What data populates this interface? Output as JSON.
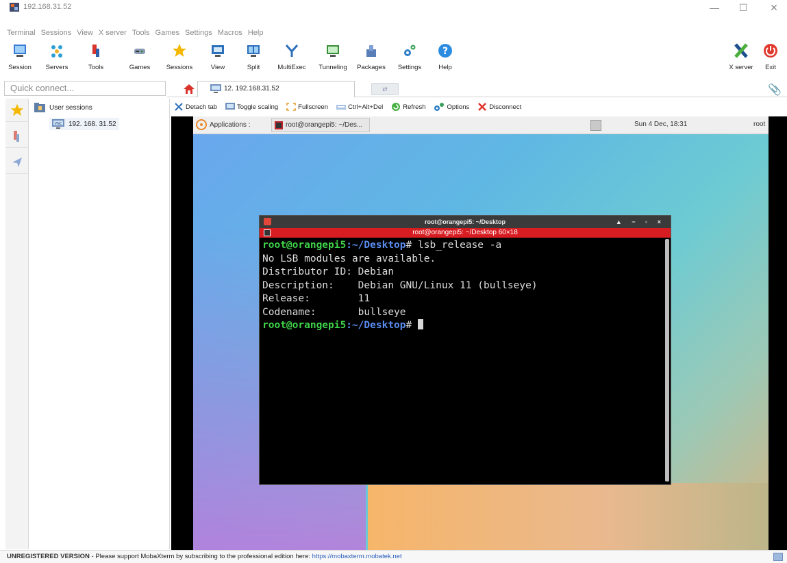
{
  "window": {
    "title": "192.168.31.52",
    "minimize": "—",
    "maximize": "☐",
    "close": "✕"
  },
  "menu": [
    "Terminal",
    "Sessions",
    "View",
    "X server",
    "Tools",
    "Games",
    "Settings",
    "Macros",
    "Help"
  ],
  "toolbar": {
    "session": "Session",
    "servers": "Servers",
    "tools": "Tools",
    "games": "Games",
    "sessions": "Sessions",
    "view": "View",
    "split": "Split",
    "multiexec": "MultiExec",
    "tunneling": "Tunneling",
    "packages": "Packages",
    "settings": "Settings",
    "help": "Help",
    "xserver": "X server",
    "exit": "Exit"
  },
  "quick_connect": {
    "placeholder": "Quick connect..."
  },
  "tabs": {
    "active_label": "12. 192.168.31.52"
  },
  "sessions": {
    "group_label": "User sessions",
    "entry_label": "192. 168. 31.52"
  },
  "session_toolbar": {
    "detach": "Detach tab",
    "toggle": "Toggle scaling",
    "fullscreen": "Fullscreen",
    "ctrlaltdel": "Ctrl+Alt+Del",
    "refresh": "Refresh",
    "options": "Options",
    "disconnect": "Disconnect"
  },
  "xpanel": {
    "applications": "Applications :",
    "task_label": "root@orangepi5: ~/Des...",
    "clock": "Sun  4 Dec, 18:31",
    "tray_text": "root"
  },
  "terminal": {
    "title": "root@orangepi5: ~/Desktop",
    "controls": "▲ − ▫ ×",
    "subtitle": "root@orangepi5: ~/Desktop 60×18",
    "prompt_user": "root@orangepi5",
    "prompt_path": ":~/Desktop",
    "prompt_hash": "# ",
    "command": "lsb_release -a",
    "output": [
      "No LSB modules are available.",
      "Distributor ID: Debian",
      "Description:    Debian GNU/Linux 11 (bullseye)",
      "Release:        11",
      "Codename:       bullseye"
    ]
  },
  "status": {
    "unregistered": "UNREGISTERED VERSION",
    "message": " -  Please support MobaXterm by subscribing to the professional edition here: ",
    "link": "https://mobaxterm.mobatek.net"
  }
}
